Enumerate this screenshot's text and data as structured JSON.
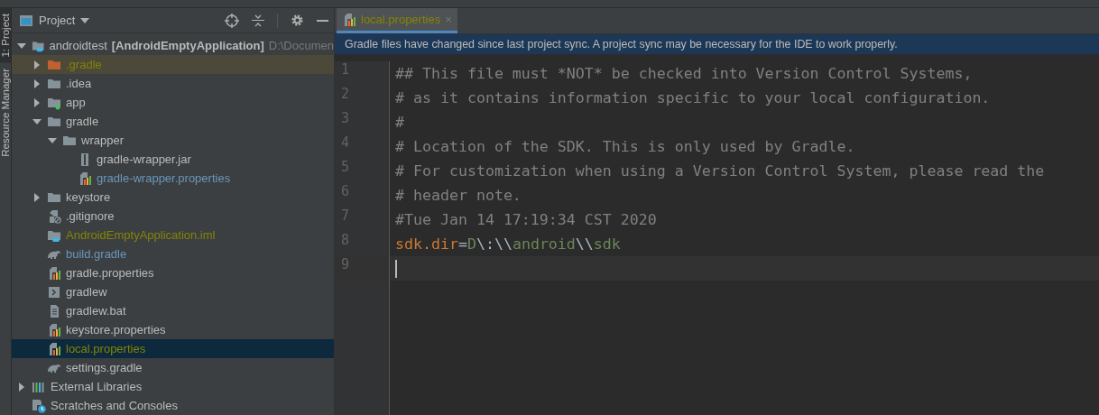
{
  "tool_strip": [
    {
      "label": "1: Project",
      "selected": true
    },
    {
      "label": "Resource Manager",
      "selected": false
    }
  ],
  "project_panel": {
    "title": "Project",
    "tree": [
      {
        "name": "androidtest",
        "module": "[AndroidEmptyApplication]",
        "path": "D:\\Documen",
        "kind": "module-folder",
        "color": "#bbbbbb",
        "selected": false,
        "expanded": true,
        "children": [
          {
            "name": ".gradle",
            "kind": "excluded-folder",
            "color": "#848504",
            "selected": false,
            "expanded": false
          },
          {
            "name": ".idea",
            "kind": "folder",
            "color": "#bbbbbb",
            "selected": false,
            "expanded": false
          },
          {
            "name": "app",
            "kind": "app-folder",
            "color": "#bbbbbb",
            "selected": false,
            "expanded": false
          },
          {
            "name": "gradle",
            "kind": "folder",
            "color": "#bbbbbb",
            "selected": false,
            "expanded": true,
            "children": [
              {
                "name": "wrapper",
                "kind": "folder",
                "color": "#bbbbbb",
                "selected": false,
                "expanded": true,
                "children": [
                  {
                    "name": "gradle-wrapper.jar",
                    "kind": "jar",
                    "color": "#bbbbbb",
                    "selected": false
                  },
                  {
                    "name": "gradle-wrapper.properties",
                    "kind": "properties",
                    "color": "#6897bb",
                    "selected": false
                  }
                ]
              }
            ]
          },
          {
            "name": "keystore",
            "kind": "folder",
            "color": "#bbbbbb",
            "selected": false,
            "expanded": false
          },
          {
            "name": ".gitignore",
            "kind": "ignore-file",
            "color": "#bbbbbb",
            "selected": false
          },
          {
            "name": "AndroidEmptyApplication.iml",
            "kind": "module-file",
            "color": "#848504",
            "selected": false
          },
          {
            "name": "build.gradle",
            "kind": "gradle",
            "color": "#6897bb",
            "selected": false
          },
          {
            "name": "gradle.properties",
            "kind": "properties",
            "color": "#bbbbbb",
            "selected": false
          },
          {
            "name": "gradlew",
            "kind": "script",
            "color": "#bbbbbb",
            "selected": false
          },
          {
            "name": "gradlew.bat",
            "kind": "text-file",
            "color": "#bbbbbb",
            "selected": false
          },
          {
            "name": "keystore.properties",
            "kind": "properties",
            "color": "#bbbbbb",
            "selected": false
          },
          {
            "name": "local.properties",
            "kind": "properties",
            "color": "#848504",
            "selected": true
          },
          {
            "name": "settings.gradle",
            "kind": "gradle",
            "color": "#bbbbbb",
            "selected": false
          }
        ]
      },
      {
        "name": "External Libraries",
        "kind": "libraries",
        "color": "#bbbbbb",
        "selected": false,
        "expanded": false
      },
      {
        "name": "Scratches and Consoles",
        "kind": "scratches",
        "color": "#bbbbbb",
        "selected": false
      }
    ]
  },
  "editor": {
    "tabs": [
      {
        "label": "local.properties",
        "close": "×",
        "color": "#848504",
        "selected": true
      }
    ],
    "banner": "Gradle files have changed since last project sync. A project sync may be necessary for the IDE to work properly.",
    "lines": [
      {
        "number": "1",
        "current": false,
        "segments": [
          {
            "text": "## This file must *NOT* be checked into Version Control Systems,",
            "kind": "comment"
          }
        ]
      },
      {
        "number": "2",
        "current": false,
        "segments": [
          {
            "text": "# as it contains information specific to your local configuration.",
            "kind": "comment"
          }
        ]
      },
      {
        "number": "3",
        "current": false,
        "segments": [
          {
            "text": "#",
            "kind": "comment"
          }
        ]
      },
      {
        "number": "4",
        "current": false,
        "segments": [
          {
            "text": "# Location of the SDK. This is only used by Gradle.",
            "kind": "comment"
          }
        ]
      },
      {
        "number": "5",
        "current": false,
        "segments": [
          {
            "text": "# For customization when using a Version Control System, please read the",
            "kind": "comment"
          }
        ]
      },
      {
        "number": "6",
        "current": false,
        "segments": [
          {
            "text": "# header note.",
            "kind": "comment"
          }
        ]
      },
      {
        "number": "7",
        "current": false,
        "segments": [
          {
            "text": "#Tue Jan 14 17:19:34 CST 2020",
            "kind": "comment"
          }
        ]
      },
      {
        "number": "8",
        "current": false,
        "segments": [
          {
            "text": "sdk.dir",
            "kind": "key"
          },
          {
            "text": "=",
            "kind": "separator"
          },
          {
            "text": "D",
            "kind": "value"
          },
          {
            "text": "\\:\\\\",
            "kind": "escape"
          },
          {
            "text": "android",
            "kind": "value"
          },
          {
            "text": "\\\\",
            "kind": "escape"
          },
          {
            "text": "sdk",
            "kind": "value"
          }
        ]
      },
      {
        "number": "9",
        "current": true
      }
    ]
  }
}
